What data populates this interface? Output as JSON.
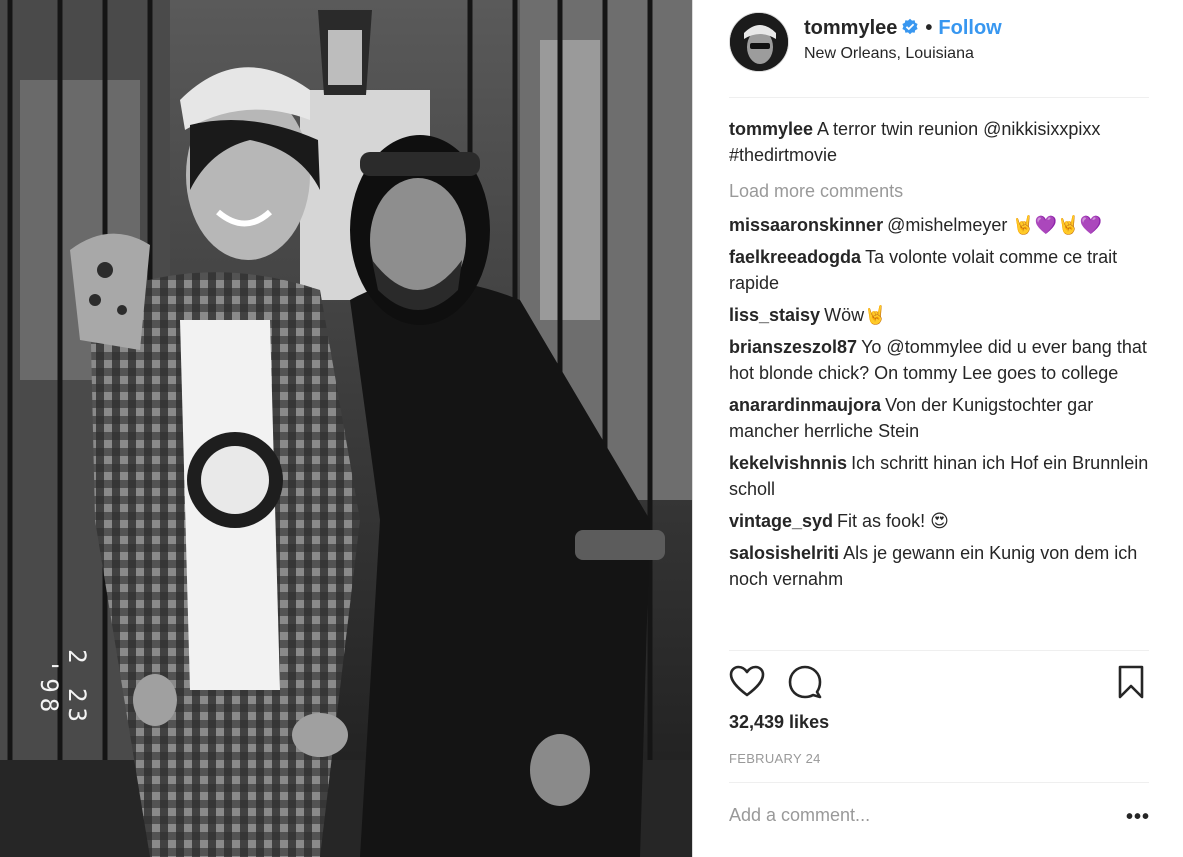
{
  "post": {
    "username": "tommylee",
    "verified": true,
    "separator": "•",
    "follow_label": "Follow",
    "location": "New Orleans, Louisiana",
    "photo_date_stamp": "2 23 '98",
    "caption": {
      "user": "tommylee",
      "text": "A terror twin reunion @nikkisixxpixx #thedirtmovie"
    },
    "load_more_label": "Load more comments",
    "comments": [
      {
        "user": "missaaronskinner",
        "text": "@mishelmeyer 🤘💜🤘💜"
      },
      {
        "user": "faelkreeadogda",
        "text": "Ta volonte volait comme ce trait rapide"
      },
      {
        "user": "liss_staisy",
        "text": "Wöw🤘"
      },
      {
        "user": "brianszeszol87",
        "text": "Yo @tommylee did u ever bang that hot blonde chick? On tommy Lee goes to college"
      },
      {
        "user": "anarardinmaujora",
        "text": "Von der Kunigstochter gar mancher herrliche Stein"
      },
      {
        "user": "kekelvishnnis",
        "text": "Ich schritt hinan ich Hof ein Brunnlein scholl"
      },
      {
        "user": "vintage_syd",
        "text": "Fit as fook! 😍"
      },
      {
        "user": "salosishelriti",
        "text": "Als je gewann ein Kunig von dem ich noch vernahm"
      }
    ],
    "likes": "32,439 likes",
    "date": "FEBRUARY 24",
    "add_comment_placeholder": "Add a comment...",
    "more_label": "•••",
    "icons": {
      "like": "heart-icon",
      "comment": "comment-bubble-icon",
      "save": "bookmark-icon",
      "verified": "verified-badge-icon",
      "more": "more-options-icon"
    },
    "colors": {
      "link": "#3897f0",
      "text": "#262626",
      "muted": "#999999",
      "divider": "#efefef"
    }
  }
}
